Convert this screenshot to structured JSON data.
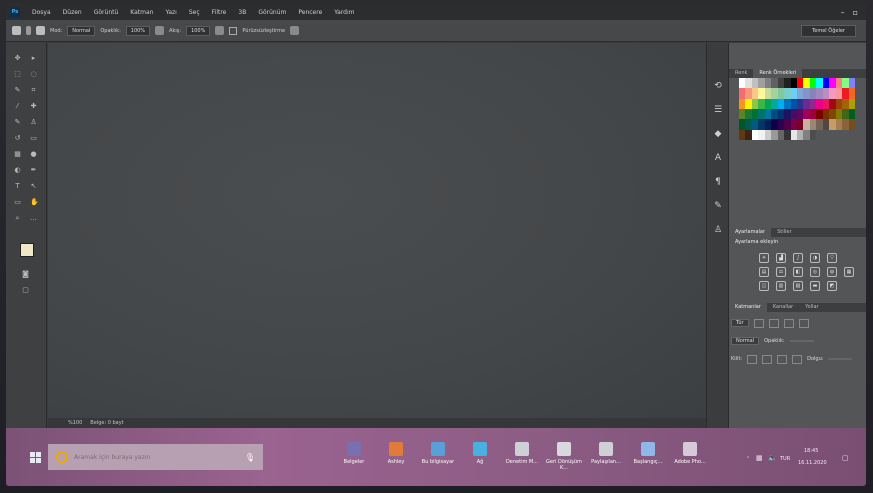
{
  "menubar": {
    "app_logo": "Ps",
    "items": [
      "Dosya",
      "Düzen",
      "Görüntü",
      "Katman",
      "Yazı",
      "Seç",
      "Filtre",
      "3B",
      "Görünüm",
      "Pencere",
      "Yardım"
    ],
    "window_controls": [
      "–",
      "▫"
    ]
  },
  "options": {
    "mode_label": "Mod:",
    "mode_value": "Normal",
    "opacity_label": "Opaklık:",
    "opacity_value": "100%",
    "flow_label": "Akış:",
    "flow_value": "100%",
    "airbrush_label": "Pürüzsüzleştirme",
    "workspace": "Temel Öğeler"
  },
  "status": {
    "zoom": "%100",
    "doc": "Belge: 0 bayt"
  },
  "panels": {
    "swatches_tabs": [
      "Renk",
      "Renk Örnekleri"
    ],
    "adjust_tabs": [
      "Ayarlamalar",
      "Stiller"
    ],
    "adjust_title": "Ayarlama ekleyin",
    "layers_tabs": [
      "Katmanlar",
      "Kanallar",
      "Yollar"
    ],
    "layers_kind": "Tür",
    "layers_mode": "Normal",
    "layers_opacity_label": "Opaklık:",
    "layers_lock_label": "Kilit:",
    "layers_fill_label": "Dolgu:",
    "swatch_colors": [
      "#ffffff",
      "#e0e0e0",
      "#c0c0c0",
      "#a0a0a0",
      "#808080",
      "#606060",
      "#404040",
      "#202020",
      "#000000",
      "#ff0000",
      "#ffff00",
      "#00ff00",
      "#00ffff",
      "#0000ff",
      "#ff00ff",
      "#ff8080",
      "#80ff80",
      "#8080ff",
      "#f26d6d",
      "#f7977a",
      "#fdc68a",
      "#fff79a",
      "#c4df9b",
      "#a3d39c",
      "#82ca9d",
      "#7bcdc8",
      "#6ecff6",
      "#7ea7d8",
      "#8493ca",
      "#8882be",
      "#a187be",
      "#bc8dbf",
      "#f49ac2",
      "#f6989d",
      "#ed1c24",
      "#f26522",
      "#f7941d",
      "#fff200",
      "#8dc63f",
      "#39b54a",
      "#00a651",
      "#00a99d",
      "#00aeef",
      "#0072bc",
      "#0054a6",
      "#2e3192",
      "#662d91",
      "#92278f",
      "#ec008c",
      "#ed145b",
      "#9e0b0f",
      "#a0410d",
      "#a36209",
      "#aba000",
      "#598527",
      "#1a7b30",
      "#007236",
      "#00746b",
      "#0076a3",
      "#004b80",
      "#003471",
      "#1b1464",
      "#440e62",
      "#630460",
      "#9e005d",
      "#9e0039",
      "#790000",
      "#7b2e00",
      "#7d4900",
      "#827b00",
      "#406618",
      "#005e20",
      "#005826",
      "#005952",
      "#005b7f",
      "#003663",
      "#002157",
      "#0d004c",
      "#32004b",
      "#4b0049",
      "#7b0046",
      "#7a0026",
      "#c7b299",
      "#998675",
      "#736357",
      "#534741",
      "#c69c6d",
      "#a67c52",
      "#8c6239",
      "#754c24",
      "#603913",
      "#3c2415",
      "#ffffff",
      "#f2f2f2",
      "#cccccc",
      "#999999",
      "#666666",
      "#333333",
      "#e6e6e6",
      "#b3b3b3",
      "#808080",
      "#4d4d4d"
    ]
  },
  "taskbar": {
    "search_placeholder": "Aramak için buraya yazın",
    "apps": [
      {
        "label": "Belgeler",
        "color": "#7a6fb0"
      },
      {
        "label": "Ashley",
        "color": "#e07b3a"
      },
      {
        "label": "Bu bilgisayar",
        "color": "#5aa0d8"
      },
      {
        "label": "Ağ",
        "color": "#4ab0e0"
      },
      {
        "label": "Denetim M...",
        "color": "#cfcfd6"
      },
      {
        "label": "Geri Dönüşüm K...",
        "color": "#d8d8de"
      },
      {
        "label": "Paylaşılan...",
        "color": "#cfcfd6"
      },
      {
        "label": "Başlangıç...",
        "color": "#8fb8e8"
      },
      {
        "label": "Adobe Pho...",
        "color": "#d6c9d8"
      }
    ],
    "tray_time": "18:45",
    "tray_date": "16.11.2020",
    "tray_lang": "TUR"
  }
}
